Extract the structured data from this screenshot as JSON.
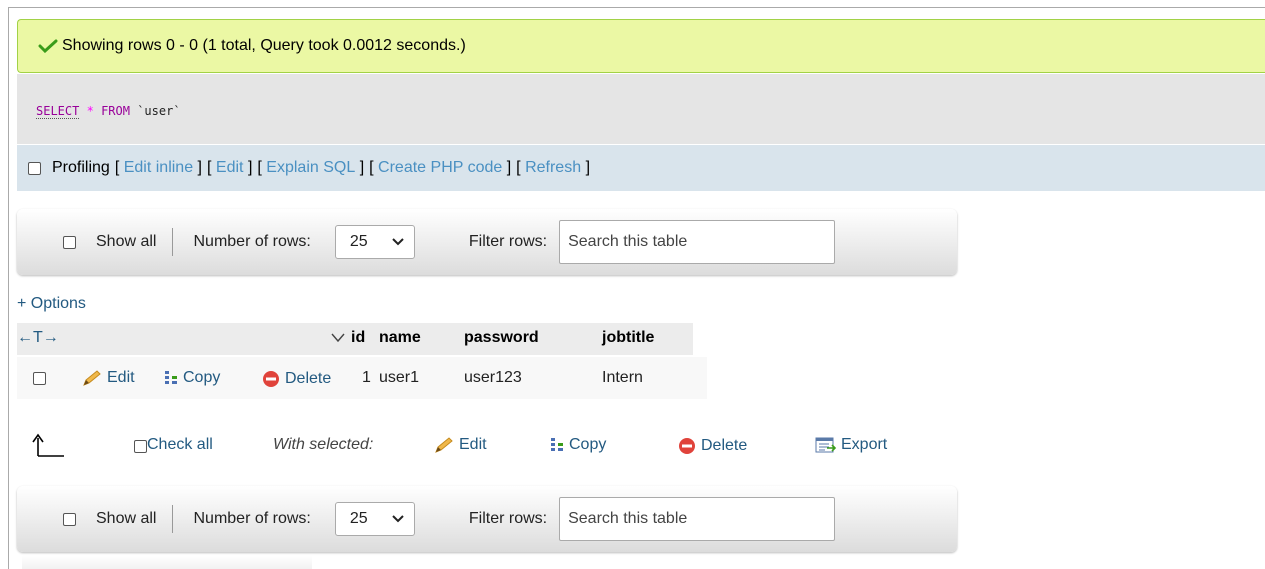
{
  "success": {
    "message": "Showing rows 0 - 0 (1 total, Query took 0.0012 seconds.)",
    "color": "#ebf8a4"
  },
  "sql": {
    "keyword": "SELECT",
    "star": "*",
    "from": "FROM",
    "table": "`user`"
  },
  "profiling": {
    "label": "Profiling",
    "links": [
      "Edit inline",
      "Edit",
      "Explain SQL",
      "Create PHP code",
      "Refresh"
    ]
  },
  "navigation": {
    "show_all": "Show all",
    "number_of_rows_label": "Number of rows:",
    "rows_value": "25",
    "filter_label": "Filter rows:",
    "search_placeholder": "Search this table"
  },
  "options_link": "+ Options",
  "table": {
    "arrows": "←T→",
    "columns": [
      "id",
      "name",
      "password",
      "jobtitle"
    ],
    "rows": [
      {
        "id": "1",
        "name": "user1",
        "password": "user123",
        "jobtitle": "Intern"
      }
    ],
    "row_actions": {
      "edit": "Edit",
      "copy": "Copy",
      "delete": "Delete"
    }
  },
  "with_selected": {
    "check_all": "Check all",
    "label": "With selected:",
    "edit": "Edit",
    "copy": "Copy",
    "delete": "Delete",
    "export": "Export"
  },
  "colors": {
    "link": "#235a81",
    "delete_icon": "#d9534f",
    "edit_icon": "#e8a33a"
  }
}
